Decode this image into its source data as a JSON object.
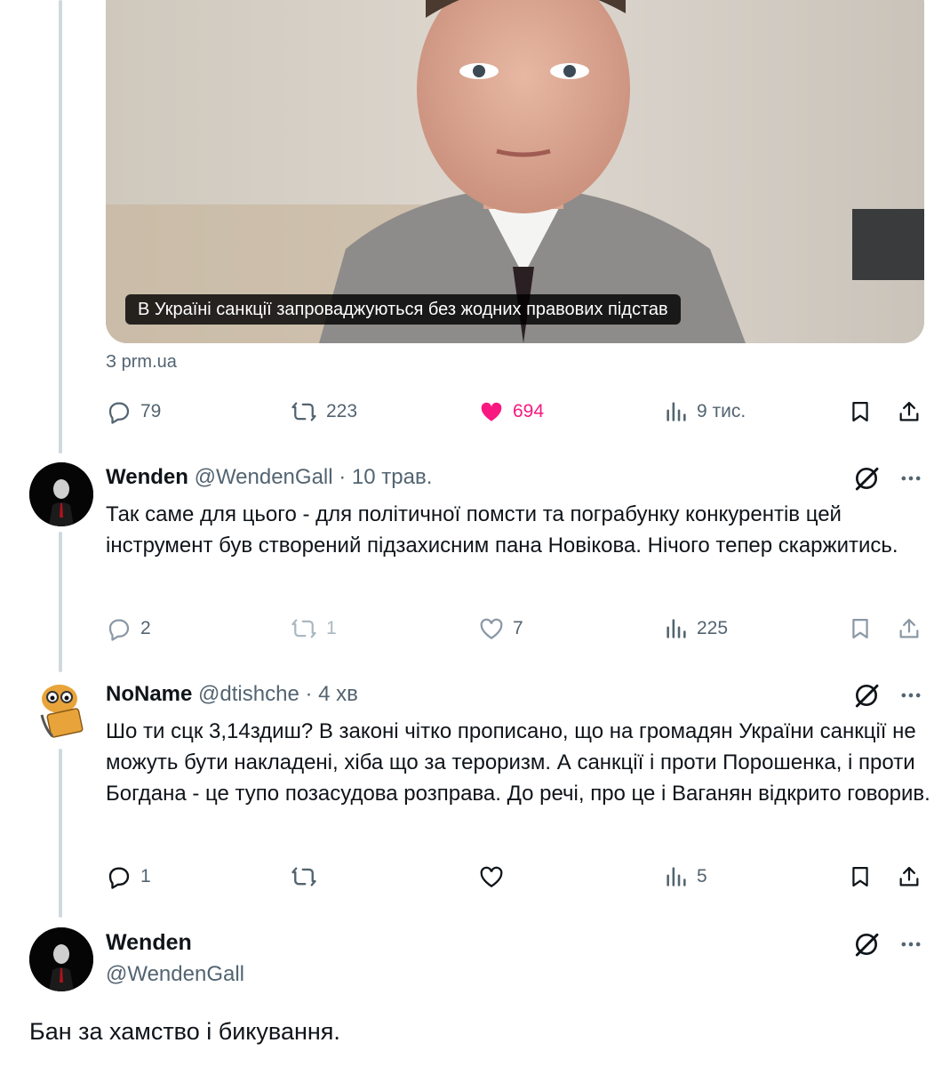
{
  "quoted_post": {
    "image_caption": "В Україні санкції запроваджуються без жодних правових підстав",
    "source": "З prm.ua",
    "actions": {
      "replies": "79",
      "reposts": "223",
      "likes": "694",
      "views": "9 тис."
    }
  },
  "replies": [
    {
      "name": "Wenden",
      "handle": "@WendenGall",
      "time": "10 трав.",
      "separator": "·",
      "text": "Так саме для цього - для політичної помсти та пограбунку конкурентів цей інструмент був створений підзахисним пана Новікова. Нічого тепер скаржитись.",
      "actions": {
        "replies": "2",
        "reposts": "1",
        "likes": "7",
        "views": "225"
      }
    },
    {
      "name": "NoName",
      "handle": "@dtishche",
      "time": "4 хв",
      "separator": "·",
      "text": "Шо ти сцк 3,14здиш? В законі чітко прописано, що на громадян України санкції не можуть бути накладені, хіба що за тероризм. А санкції і проти Порошенка, і проти Богдана - це тупо позасудова розправа. До речі, про це і Ваганян відкрито говорив.",
      "actions": {
        "replies": "1",
        "reposts": "",
        "likes": "",
        "views": "5"
      }
    }
  ],
  "main_post": {
    "name": "Wenden",
    "handle": "@WendenGall",
    "text": "Бан за хамство і бикування."
  },
  "colors": {
    "text": "#0f1419",
    "secondary": "#536471",
    "like": "#f91880",
    "line": "#cfd9de"
  }
}
